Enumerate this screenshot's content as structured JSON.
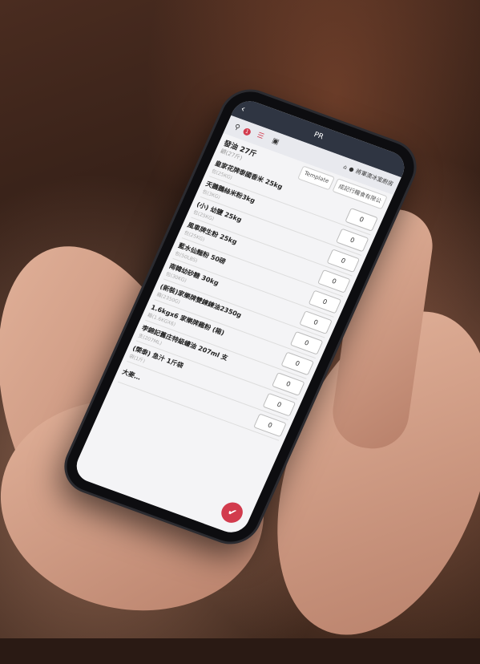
{
  "nav": {
    "back": "‹",
    "title": "PR"
  },
  "toolbar": {
    "badge": "1",
    "shop_name": "將軍澳冰室廚房"
  },
  "header": {
    "first_item": {
      "name": "發油 27斤",
      "sub": "顧(27斤)"
    },
    "template_label": "Template",
    "supplier": "成記行糧食有限公"
  },
  "items": [
    {
      "name": "皇家花牌泰國香米 25kg",
      "sub": "包(25KG)",
      "qty": "0"
    },
    {
      "name": "天鵝鵝絲米粉3kg",
      "sub": "包(3KG)",
      "qty": "0"
    },
    {
      "name": "(小) 幼鹽 25kg",
      "sub": "包(25KG)",
      "qty": "0"
    },
    {
      "name": "風車牌生粉 25kg",
      "sub": "包(25KG)",
      "qty": "0"
    },
    {
      "name": "藍水仙麵粉 50磅",
      "sub": "包(50LBS)",
      "qty": "0"
    },
    {
      "name": "南韓幼砂糖 30kg",
      "sub": "包(30KG)",
      "qty": "0"
    },
    {
      "name": "(新裝)家樂牌雙鍊鍊油2350g",
      "sub": "箱(2350G)",
      "qty": "0"
    },
    {
      "name": "1.6kgx6 家樂牌雞粉 (箱)",
      "sub": "箱(1.6KGX6)",
      "qty": "0"
    },
    {
      "name": "李錦記舊庄特級蠔油 207ml 支",
      "sub": "支(207ML)",
      "qty": "0"
    },
    {
      "name": "(榮泰) 急汁 1斤袋",
      "sub": "袋(1斤)",
      "qty": "0"
    },
    {
      "name": "大麥…",
      "sub": "",
      "qty": "0"
    }
  ],
  "fab_icon": "check-icon"
}
